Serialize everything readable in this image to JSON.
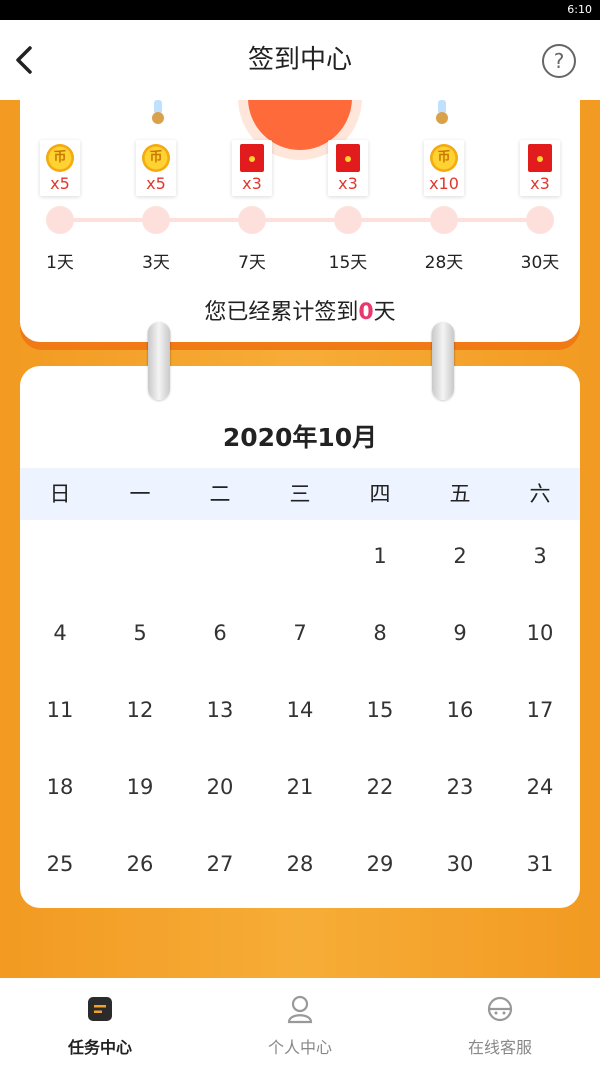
{
  "status_bar": {
    "time": "6:10"
  },
  "header": {
    "title": "签到中心",
    "help_label": "?",
    "back_icon": "chevron-left-icon"
  },
  "rewards": [
    {
      "type": "coin",
      "icon": "coin-icon",
      "glyph": "币",
      "count": "x5",
      "day": "1天"
    },
    {
      "type": "coin",
      "icon": "coin-icon",
      "glyph": "币",
      "count": "x5",
      "day": "3天"
    },
    {
      "type": "packet",
      "icon": "red-packet-icon",
      "glyph": "",
      "count": "x3",
      "day": "7天"
    },
    {
      "type": "packet",
      "icon": "red-packet-icon",
      "glyph": "",
      "count": "x3",
      "day": "15天"
    },
    {
      "type": "coin",
      "icon": "coin-icon",
      "glyph": "币",
      "count": "x10",
      "day": "28天"
    },
    {
      "type": "packet",
      "icon": "red-packet-icon",
      "glyph": "",
      "count": "x3",
      "day": "30天"
    }
  ],
  "summary": {
    "prefix": "您已经累计签到",
    "count": "0",
    "suffix": "天"
  },
  "calendar": {
    "title": "2020年10月",
    "weekdays": [
      "日",
      "一",
      "二",
      "三",
      "四",
      "五",
      "六"
    ],
    "first_weekday_index": 4,
    "days_in_month": 31
  },
  "tabs": [
    {
      "label": "任务中心",
      "icon": "task-icon",
      "active": true
    },
    {
      "label": "个人中心",
      "icon": "user-icon",
      "active": false
    },
    {
      "label": "在线客服",
      "icon": "support-icon",
      "active": false
    }
  ],
  "colors": {
    "accent": "#f3a12b",
    "highlight": "#e8386d",
    "coin": "#ffd233",
    "packet": "#e21c1c"
  }
}
